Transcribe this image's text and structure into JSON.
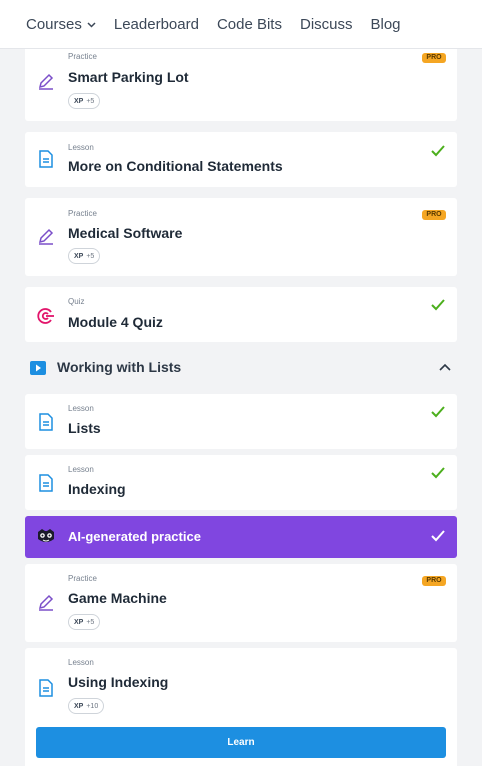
{
  "nav": {
    "courses": "Courses",
    "leaderboard": "Leaderboard",
    "code_bits": "Code Bits",
    "discuss": "Discuss",
    "blog": "Blog"
  },
  "items": [
    {
      "type": "Practice",
      "title": "Smart Parking Lot",
      "xp_label": "XP",
      "xp": "+5",
      "badge": "PRO",
      "icon": "pencil-icon"
    },
    {
      "type": "Lesson",
      "title": "More on Conditional Statements",
      "completed": true,
      "icon": "document-icon"
    },
    {
      "type": "Practice",
      "title": "Medical Software",
      "xp_label": "XP",
      "xp": "+5",
      "badge": "PRO",
      "icon": "pencil-icon"
    },
    {
      "type": "Quiz",
      "title": "Module 4 Quiz",
      "completed": true,
      "icon": "quiz-target-icon"
    }
  ],
  "module": {
    "title": "Working with Lists",
    "expanded": true,
    "icon": "play-icon",
    "items": [
      {
        "type": "Lesson",
        "title": "Lists",
        "completed": true,
        "icon": "document-icon"
      },
      {
        "type": "Lesson",
        "title": "Indexing",
        "completed": true,
        "icon": "document-icon"
      },
      {
        "title": "AI-generated practice",
        "completed": true,
        "highlight_color": "#8046e0",
        "icon": "ai-mask-icon"
      },
      {
        "type": "Practice",
        "title": "Game Machine",
        "xp_label": "XP",
        "xp": "+5",
        "badge": "PRO",
        "icon": "pencil-icon"
      },
      {
        "type": "Lesson",
        "title": "Using Indexing",
        "xp_label": "XP",
        "xp": "+10",
        "button": "Learn",
        "icon": "document-icon"
      }
    ]
  },
  "colors": {
    "accent_blue": "#1d8fe1",
    "check_green": "#4caf1d",
    "pro_badge": "#f5a623",
    "practice_purple": "#7b4fc9",
    "quiz_pink": "#e2156b"
  }
}
